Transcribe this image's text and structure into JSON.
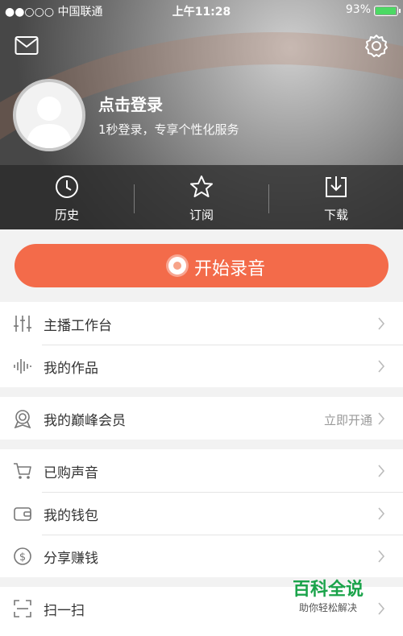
{
  "status": {
    "carrier": "●●○○○ 中国联通",
    "time": "上午11:28",
    "battery": "93%",
    "battery_level": 0.93
  },
  "header": {
    "login_title": "点击登录",
    "login_subtitle": "1秒登录，专享个性化服务"
  },
  "quick": {
    "history": "历史",
    "subscribe": "订阅",
    "download": "下载"
  },
  "record": {
    "label": "开始录音"
  },
  "menu": {
    "anchor_workbench": "主播工作台",
    "my_works": "我的作品",
    "vip": "我的巅峰会员",
    "vip_action": "立即开通",
    "purchased": "已购声音",
    "wallet": "我的钱包",
    "share_earn": "分享赚钱",
    "scan": "扫一扫"
  },
  "watermark": {
    "title": "百科全说",
    "subtitle": "助你轻松解决"
  },
  "colors": {
    "accent": "#f36b4a",
    "battery": "#4cd964",
    "watermark": "#1aa34a"
  }
}
